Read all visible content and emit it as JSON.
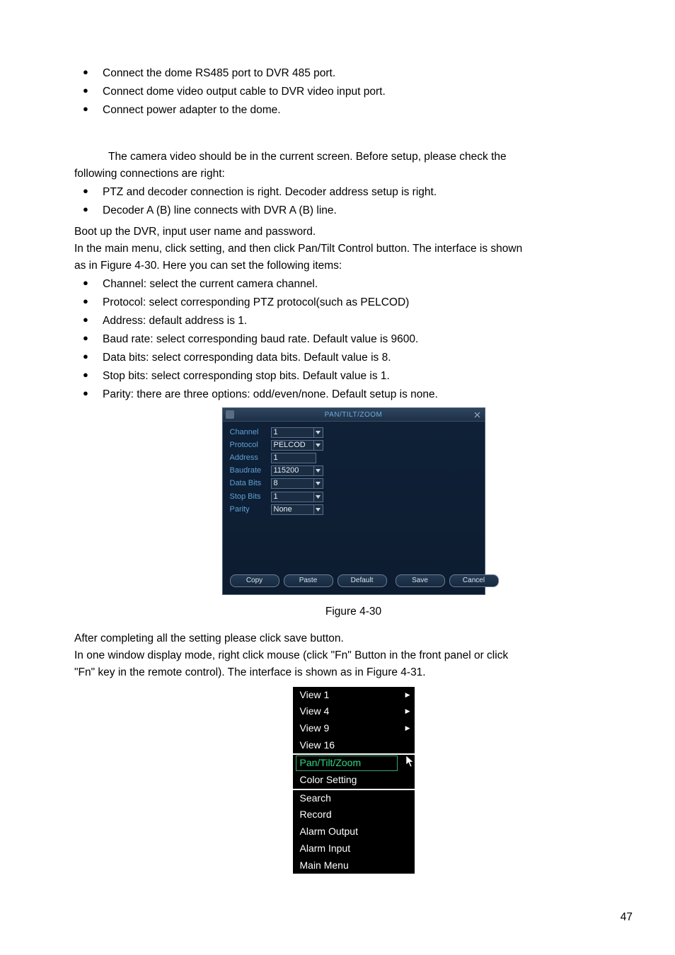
{
  "intro_bullets": [
    "Connect the dome RS485 port to DVR 485 port.",
    "Connect dome video output cable to DVR video input port.",
    "Connect power adapter to the dome."
  ],
  "para1_line1": "The camera video should be in the current screen. Before setup, please check the",
  "para1_line2": "following connections are right:",
  "check_bullets": [
    "PTZ and decoder connection is right. Decoder address setup is right.",
    "Decoder A (B) line connects with DVR A (B) line."
  ],
  "boot_line": "Boot up the DVR, input user name and password.",
  "mainmenu_line1": "In the main menu, click setting, and then click Pan/Tilt Control button. The interface is shown",
  "mainmenu_line2": "as in Figure 4-30. Here you can set the following items:",
  "setting_bullets": [
    "Channel: select the current camera channel.",
    "Protocol: select corresponding PTZ protocol(such as PELCOD)",
    "Address: default address is 1.",
    "Baud rate: select corresponding baud rate. Default value is 9600.",
    "Data bits: select corresponding data bits. Default value is 8.",
    "Stop bits: select corresponding stop bits. Default value is 1.",
    "Parity: there are three options: odd/even/none. Default setup is none."
  ],
  "ptz": {
    "title": "PAN/TILT/ZOOM",
    "fields": {
      "channel": {
        "label": "Channel",
        "value": "1",
        "type": "select"
      },
      "protocol": {
        "label": "Protocol",
        "value": "PELCOD",
        "type": "select"
      },
      "address": {
        "label": "Address",
        "value": "1",
        "type": "input"
      },
      "baudrate": {
        "label": "Baudrate",
        "value": "115200",
        "type": "select"
      },
      "databits": {
        "label": "Data Bits",
        "value": "8",
        "type": "select"
      },
      "stopbits": {
        "label": "Stop Bits",
        "value": "1",
        "type": "select"
      },
      "parity": {
        "label": "Parity",
        "value": "None",
        "type": "select"
      }
    },
    "buttons": {
      "copy": "Copy",
      "paste": "Paste",
      "default": "Default",
      "save": "Save",
      "cancel": "Cancel"
    }
  },
  "caption1": "Figure 4-30",
  "after1": "After completing all the setting please click save button.",
  "after2": "In one window display mode, right click mouse (click \"Fn\" Button in the front panel or click",
  "after3": "\"Fn\" key in the remote control). The interface is shown as in Figure 4-31.",
  "ctx": {
    "group1": [
      {
        "label": "View 1",
        "sub": true
      },
      {
        "label": "View 4",
        "sub": true
      },
      {
        "label": "View 9",
        "sub": true
      },
      {
        "label": "View 16",
        "sub": false
      }
    ],
    "group2": [
      {
        "label": "Pan/Tilt/Zoom",
        "selected": true
      },
      {
        "label": "Color Setting"
      }
    ],
    "group3": [
      {
        "label": "Search"
      },
      {
        "label": "Record"
      },
      {
        "label": "Alarm Output"
      },
      {
        "label": "Alarm Input"
      },
      {
        "label": "Main Menu"
      }
    ]
  },
  "page_number": "47"
}
